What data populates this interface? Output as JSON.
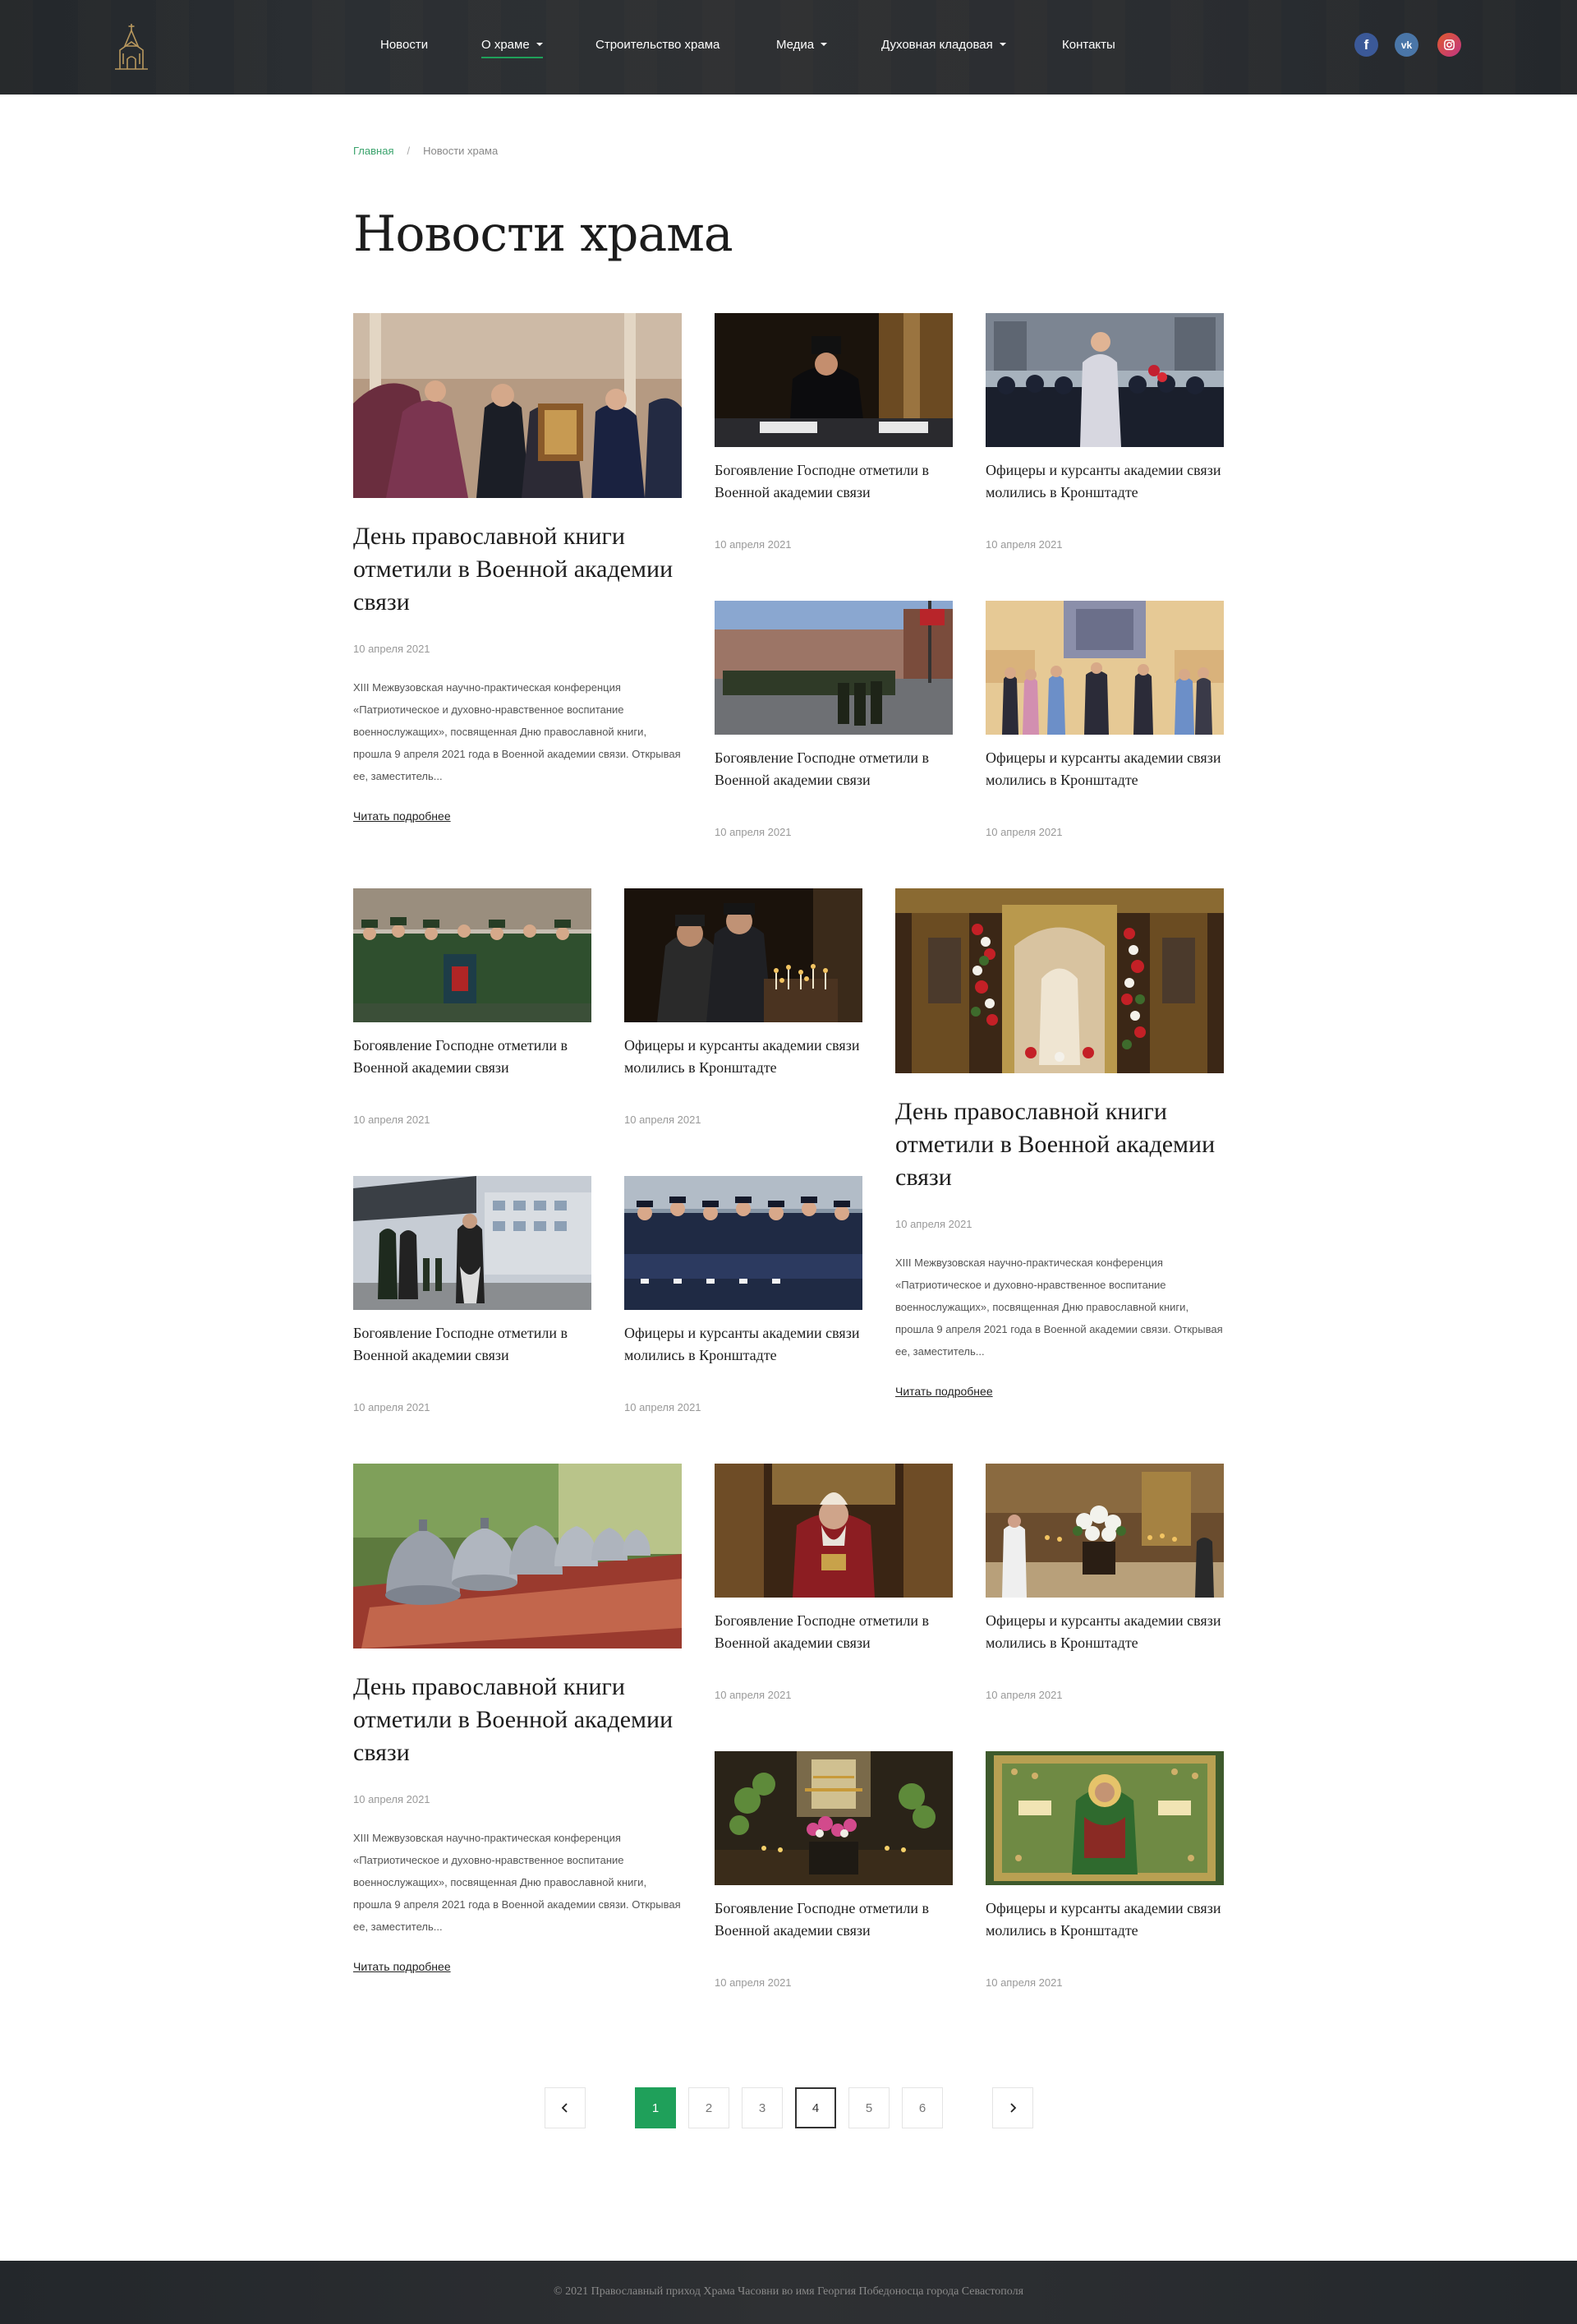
{
  "nav": {
    "items": [
      {
        "label": "Новости",
        "dropdown": false,
        "active": false
      },
      {
        "label": "О храме",
        "dropdown": true,
        "active": true
      },
      {
        "label": "Строительство храма",
        "dropdown": false,
        "active": false
      },
      {
        "label": "Медиа",
        "dropdown": true,
        "active": false
      },
      {
        "label": "Духовная кладовая",
        "dropdown": true,
        "active": false
      },
      {
        "label": "Контакты",
        "dropdown": false,
        "active": false
      }
    ],
    "social": [
      {
        "icon": "facebook-icon",
        "glyph": "f",
        "color": "#3b5998"
      },
      {
        "icon": "vk-icon",
        "glyph": "vk",
        "color": "#4a76a8"
      },
      {
        "icon": "instagram-icon",
        "glyph": "◎",
        "color": "#c13584"
      }
    ]
  },
  "breadcrumb": {
    "home": "Главная",
    "current": "Новости храма"
  },
  "page_title": "Новости храма",
  "groups": [
    {
      "big": {
        "title": "День православной книги отметили в Военной академии связи",
        "date": "10 апреля 2021",
        "excerpt": "XIII Межвузовская научно-практическая конференция «Патриотическое и духовно-нравственное воспитание военнослужащих», посвященная Дню православной книги, прошла 9 апреля 2021 года в Военной академии связи. Открывая ее, заместитель...",
        "more": "Читать подробнее"
      },
      "small": [
        {
          "title": "Богоявление Господне отметили в Военной академии связи",
          "date": "10 апреля 2021"
        },
        {
          "title": "Офицеры и курсанты академии связи молились в Кронштадте",
          "date": "10 апреля 2021"
        },
        {
          "title": "Богоявление Господне отметили в Военной академии связи",
          "date": "10 апреля 2021"
        },
        {
          "title": "Офицеры и курсанты академии связи молились в Кронштадте",
          "date": "10 апреля 2021"
        }
      ]
    },
    {
      "big": {
        "title": "День православной книги отметили в Военной академии связи",
        "date": "10 апреля 2021",
        "excerpt": "XIII Межвузовская научно-практическая конференция «Патриотическое и духовно-нравственное воспитание военнослужащих», посвященная Дню православной книги, прошла 9 апреля 2021 года в Военной академии связи. Открывая ее, заместитель...",
        "more": "Читать подробнее"
      },
      "small": [
        {
          "title": "Богоявление Господне отметили в Военной академии связи",
          "date": "10 апреля 2021"
        },
        {
          "title": "Офицеры и курсанты академии связи молились в Кронштадте",
          "date": "10 апреля 2021"
        },
        {
          "title": "Богоявление Господне отметили в Военной академии связи",
          "date": "10 апреля 2021"
        },
        {
          "title": "Офицеры и курсанты академии связи молились в Кронштадте",
          "date": "10 апреля 2021"
        }
      ]
    },
    {
      "big": {
        "title": "День православной книги отметили в Военной академии связи",
        "date": "10 апреля 2021",
        "excerpt": "XIII Межвузовская научно-практическая конференция «Патриотическое и духовно-нравственное воспитание военнослужащих», посвященная Дню православной книги, прошла 9 апреля 2021 года в Военной академии связи. Открывая ее, заместитель...",
        "more": "Читать подробнее"
      },
      "small": [
        {
          "title": "Богоявление Господне отметили в Военной академии связи",
          "date": "10 апреля 2021"
        },
        {
          "title": "Офицеры и курсанты академии связи молились в Кронштадте",
          "date": "10 апреля 2021"
        },
        {
          "title": "Богоявление Господне отметили в Военной академии связи",
          "date": "10 апреля 2021"
        },
        {
          "title": "Офицеры и курсанты академии связи молились в Кронштадте",
          "date": "10 апреля 2021"
        }
      ]
    }
  ],
  "pagination": {
    "pages": [
      "1",
      "2",
      "3",
      "4",
      "5",
      "6"
    ],
    "current": "1",
    "outlined": "4"
  },
  "footer": {
    "text": "© 2021 Православный приход Храма Часовни во имя Георгия Победоносца города Севастополя"
  },
  "colors": {
    "accent": "#1fa05a",
    "header": "#2a2d31"
  }
}
